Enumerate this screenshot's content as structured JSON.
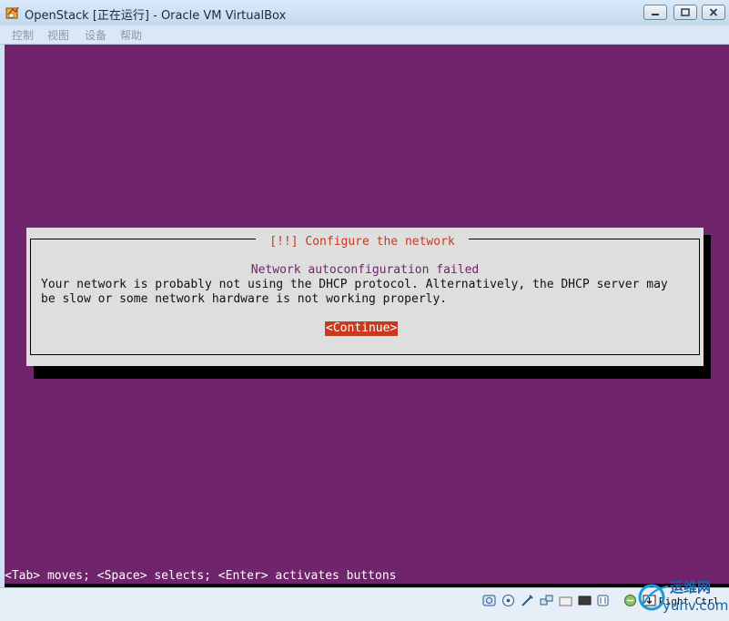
{
  "window": {
    "title": "OpenStack [正在运行] - Oracle VM VirtualBox",
    "buttons": {
      "minimize": "minimize-icon",
      "maximize": "maximize-icon",
      "close": "close-icon"
    }
  },
  "menubar": {
    "items": [
      "控制",
      "视图",
      "设备",
      "帮助"
    ]
  },
  "installer": {
    "dialog_title": "[!!] Configure the network",
    "heading": "Network autoconfiguration failed",
    "body_lines": [
      "Your network is probably not using the DHCP protocol. Alternatively, the DHCP server may",
      "be slow or some network hardware is not working properly."
    ],
    "continue_button": "<Continue>",
    "status_line": "<Tab> moves; <Space> selects; <Enter> activates buttons"
  },
  "statusbar": {
    "icons": [
      "hard-disk-icon",
      "optical-drive-icon",
      "usb-icon",
      "network-icon",
      "shared-folder-icon",
      "display-icon",
      "video-capture-icon",
      "mouse-integration-icon",
      "keyboard-icon"
    ],
    "host_key": "Right Ctrl"
  },
  "watermark": {
    "text": "运维网",
    "url": "yunv.com"
  },
  "colors": {
    "screen_bg": "#6f246c",
    "dialog_bg": "#dedede",
    "accent_red": "#c63a1f"
  }
}
